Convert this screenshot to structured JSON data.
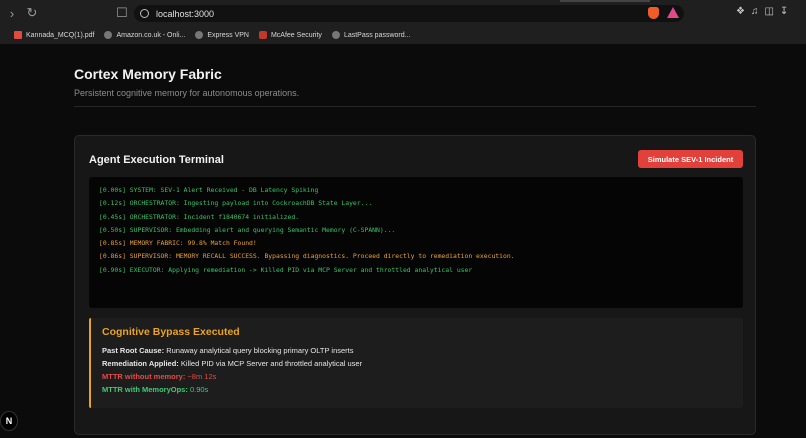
{
  "browser": {
    "url": "localhost:3000",
    "bookmarks": [
      {
        "label": "Kannada_MCQ(1).pdf",
        "icon": "pdf-icon"
      },
      {
        "label": "Amazon.co.uk - Onli...",
        "icon": "globe-icon"
      },
      {
        "label": "Express VPN",
        "icon": "globe-icon"
      },
      {
        "label": "McAfee Security",
        "icon": "mcafee-icon"
      },
      {
        "label": "LastPass password...",
        "icon": "globe-icon"
      }
    ]
  },
  "header": {
    "title": "Cortex Memory Fabric",
    "subtitle": "Persistent cognitive memory for autonomous operations."
  },
  "terminal": {
    "title": "Agent Execution Terminal",
    "button_label": "Simulate SEV-1 Incident",
    "logs": [
      {
        "text": "[0.00s] SYSTEM: SEV-1 Alert Received - DB Latency Spiking",
        "color": "green"
      },
      {
        "text": "[0.12s] ORCHESTRATOR: Ingesting payload into CockroachDB State Layer...",
        "color": "green"
      },
      {
        "text": "[0.45s] ORCHESTRATOR: Incident f1840674 initialized.",
        "color": "green"
      },
      {
        "text": "[0.50s] SUPERVISOR: Embedding alert and querying Semantic Memory (C-SPANN)...",
        "color": "green"
      },
      {
        "text": "[0.85s] MEMORY FABRIC: 99.8% Match Found!",
        "color": "orange"
      },
      {
        "text": "[0.86s] SUPERVISOR: MEMORY RECALL SUCCESS. Bypassing diagnostics. Proceed directly to remediation execution.",
        "color": "orange"
      },
      {
        "text": "[0.90s] EXECUTOR: Applying remediation -> Killed PID via MCP Server and throttled analytical user",
        "color": "green"
      }
    ]
  },
  "bypass": {
    "title": "Cognitive Bypass Executed",
    "root_cause_label": "Past Root Cause:",
    "root_cause_value": "Runaway analytical query blocking primary OLTP inserts",
    "remediation_label": "Remediation Applied:",
    "remediation_value": "Killed PID via MCP Server and throttled analytical user",
    "mttr_without_label": "MTTR without memory:",
    "mttr_without_value": "~8m 12s",
    "mttr_with_label": "MTTR with MemoryOps:",
    "mttr_with_value": "0.90s"
  },
  "colors": {
    "accent_red": "#e2403a",
    "accent_orange": "#e9a325",
    "log_green": "#39c46a"
  },
  "badge": "N"
}
